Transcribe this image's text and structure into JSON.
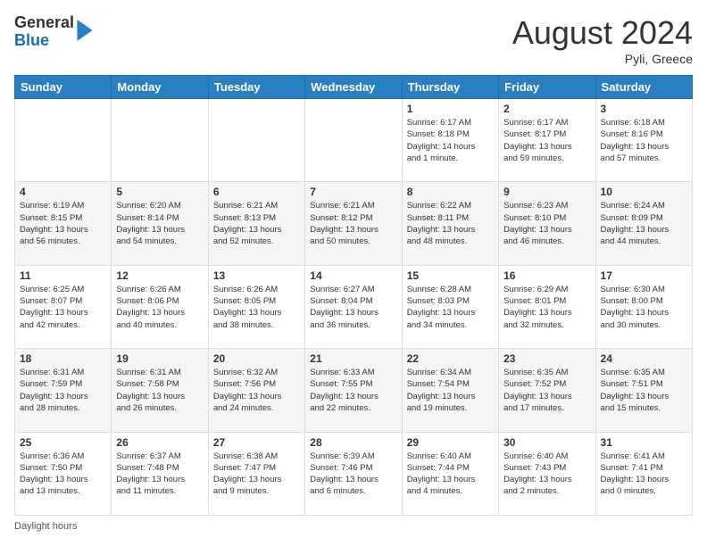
{
  "logo": {
    "general": "General",
    "blue": "Blue"
  },
  "header": {
    "month": "August 2024",
    "location": "Pyli, Greece"
  },
  "days_of_week": [
    "Sunday",
    "Monday",
    "Tuesday",
    "Wednesday",
    "Thursday",
    "Friday",
    "Saturday"
  ],
  "weeks": [
    [
      {
        "day": "",
        "info": ""
      },
      {
        "day": "",
        "info": ""
      },
      {
        "day": "",
        "info": ""
      },
      {
        "day": "",
        "info": ""
      },
      {
        "day": "1",
        "info": "Sunrise: 6:17 AM\nSunset: 8:18 PM\nDaylight: 14 hours\nand 1 minute."
      },
      {
        "day": "2",
        "info": "Sunrise: 6:17 AM\nSunset: 8:17 PM\nDaylight: 13 hours\nand 59 minutes."
      },
      {
        "day": "3",
        "info": "Sunrise: 6:18 AM\nSunset: 8:16 PM\nDaylight: 13 hours\nand 57 minutes."
      }
    ],
    [
      {
        "day": "4",
        "info": "Sunrise: 6:19 AM\nSunset: 8:15 PM\nDaylight: 13 hours\nand 56 minutes."
      },
      {
        "day": "5",
        "info": "Sunrise: 6:20 AM\nSunset: 8:14 PM\nDaylight: 13 hours\nand 54 minutes."
      },
      {
        "day": "6",
        "info": "Sunrise: 6:21 AM\nSunset: 8:13 PM\nDaylight: 13 hours\nand 52 minutes."
      },
      {
        "day": "7",
        "info": "Sunrise: 6:21 AM\nSunset: 8:12 PM\nDaylight: 13 hours\nand 50 minutes."
      },
      {
        "day": "8",
        "info": "Sunrise: 6:22 AM\nSunset: 8:11 PM\nDaylight: 13 hours\nand 48 minutes."
      },
      {
        "day": "9",
        "info": "Sunrise: 6:23 AM\nSunset: 8:10 PM\nDaylight: 13 hours\nand 46 minutes."
      },
      {
        "day": "10",
        "info": "Sunrise: 6:24 AM\nSunset: 8:09 PM\nDaylight: 13 hours\nand 44 minutes."
      }
    ],
    [
      {
        "day": "11",
        "info": "Sunrise: 6:25 AM\nSunset: 8:07 PM\nDaylight: 13 hours\nand 42 minutes."
      },
      {
        "day": "12",
        "info": "Sunrise: 6:26 AM\nSunset: 8:06 PM\nDaylight: 13 hours\nand 40 minutes."
      },
      {
        "day": "13",
        "info": "Sunrise: 6:26 AM\nSunset: 8:05 PM\nDaylight: 13 hours\nand 38 minutes."
      },
      {
        "day": "14",
        "info": "Sunrise: 6:27 AM\nSunset: 8:04 PM\nDaylight: 13 hours\nand 36 minutes."
      },
      {
        "day": "15",
        "info": "Sunrise: 6:28 AM\nSunset: 8:03 PM\nDaylight: 13 hours\nand 34 minutes."
      },
      {
        "day": "16",
        "info": "Sunrise: 6:29 AM\nSunset: 8:01 PM\nDaylight: 13 hours\nand 32 minutes."
      },
      {
        "day": "17",
        "info": "Sunrise: 6:30 AM\nSunset: 8:00 PM\nDaylight: 13 hours\nand 30 minutes."
      }
    ],
    [
      {
        "day": "18",
        "info": "Sunrise: 6:31 AM\nSunset: 7:59 PM\nDaylight: 13 hours\nand 28 minutes."
      },
      {
        "day": "19",
        "info": "Sunrise: 6:31 AM\nSunset: 7:58 PM\nDaylight: 13 hours\nand 26 minutes."
      },
      {
        "day": "20",
        "info": "Sunrise: 6:32 AM\nSunset: 7:56 PM\nDaylight: 13 hours\nand 24 minutes."
      },
      {
        "day": "21",
        "info": "Sunrise: 6:33 AM\nSunset: 7:55 PM\nDaylight: 13 hours\nand 22 minutes."
      },
      {
        "day": "22",
        "info": "Sunrise: 6:34 AM\nSunset: 7:54 PM\nDaylight: 13 hours\nand 19 minutes."
      },
      {
        "day": "23",
        "info": "Sunrise: 6:35 AM\nSunset: 7:52 PM\nDaylight: 13 hours\nand 17 minutes."
      },
      {
        "day": "24",
        "info": "Sunrise: 6:35 AM\nSunset: 7:51 PM\nDaylight: 13 hours\nand 15 minutes."
      }
    ],
    [
      {
        "day": "25",
        "info": "Sunrise: 6:36 AM\nSunset: 7:50 PM\nDaylight: 13 hours\nand 13 minutes."
      },
      {
        "day": "26",
        "info": "Sunrise: 6:37 AM\nSunset: 7:48 PM\nDaylight: 13 hours\nand 11 minutes."
      },
      {
        "day": "27",
        "info": "Sunrise: 6:38 AM\nSunset: 7:47 PM\nDaylight: 13 hours\nand 9 minutes."
      },
      {
        "day": "28",
        "info": "Sunrise: 6:39 AM\nSunset: 7:46 PM\nDaylight: 13 hours\nand 6 minutes."
      },
      {
        "day": "29",
        "info": "Sunrise: 6:40 AM\nSunset: 7:44 PM\nDaylight: 13 hours\nand 4 minutes."
      },
      {
        "day": "30",
        "info": "Sunrise: 6:40 AM\nSunset: 7:43 PM\nDaylight: 13 hours\nand 2 minutes."
      },
      {
        "day": "31",
        "info": "Sunrise: 6:41 AM\nSunset: 7:41 PM\nDaylight: 13 hours\nand 0 minutes."
      }
    ]
  ],
  "footer": {
    "note": "Daylight hours"
  }
}
